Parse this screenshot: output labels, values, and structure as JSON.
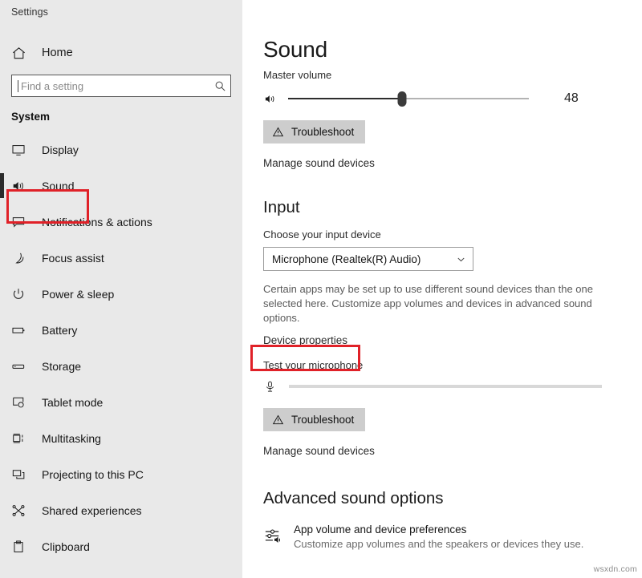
{
  "app": {
    "title": "Settings",
    "watermark": "wsxdn.com"
  },
  "colors": {
    "annotation": "#e02128",
    "sidebar_bg": "#e9e9e9",
    "main_bg": "#ffffff",
    "button_bg": "#cdcdcd",
    "slider_fill": "#2d2d2d",
    "slider_rest": "#b3b3b3"
  },
  "sidebar": {
    "home_label": "Home",
    "home_icon": "home-icon",
    "search": {
      "placeholder": "Find a setting",
      "value": "",
      "icon": "search-icon"
    },
    "section_title": "System",
    "items": [
      {
        "label": "Display",
        "icon": "monitor-icon",
        "selected": false
      },
      {
        "label": "Sound",
        "icon": "speaker-icon",
        "selected": true
      },
      {
        "label": "Notifications & actions",
        "icon": "speech-bubble-icon",
        "selected": false
      },
      {
        "label": "Focus assist",
        "icon": "moon-icon",
        "selected": false
      },
      {
        "label": "Power & sleep",
        "icon": "power-icon",
        "selected": false
      },
      {
        "label": "Battery",
        "icon": "battery-icon",
        "selected": false
      },
      {
        "label": "Storage",
        "icon": "storage-icon",
        "selected": false
      },
      {
        "label": "Tablet mode",
        "icon": "tablet-icon",
        "selected": false
      },
      {
        "label": "Multitasking",
        "icon": "multitasking-icon",
        "selected": false
      },
      {
        "label": "Projecting to this PC",
        "icon": "projecting-icon",
        "selected": false
      },
      {
        "label": "Shared experiences",
        "icon": "share-icon",
        "selected": false
      },
      {
        "label": "Clipboard",
        "icon": "clipboard-icon",
        "selected": false
      }
    ]
  },
  "main": {
    "page_title": "Sound",
    "output": {
      "master_volume_label": "Master volume",
      "volume_value": "48",
      "volume_percent": 48,
      "speaker_icon": "speaker-icon",
      "troubleshoot_label": "Troubleshoot",
      "troubleshoot_icon": "warning-triangle-icon",
      "manage_link": "Manage sound devices"
    },
    "input": {
      "heading": "Input",
      "choose_label": "Choose your input device",
      "device_value": "Microphone (Realtek(R) Audio)",
      "chevron_icon": "chevron-down-icon",
      "description": "Certain apps may be set up to use different sound devices than the one selected here. Customize app volumes and devices in advanced sound options.",
      "device_properties_link": "Device properties",
      "test_label": "Test your microphone",
      "mic_icon": "microphone-icon",
      "mic_level_percent": 0,
      "troubleshoot_label": "Troubleshoot",
      "troubleshoot_icon": "warning-triangle-icon",
      "manage_link": "Manage sound devices"
    },
    "advanced": {
      "heading": "Advanced sound options",
      "icon": "app-volume-mixer-icon",
      "item_title": "App volume and device preferences",
      "item_desc": "Customize app volumes and the speakers or devices they use."
    }
  },
  "annotations": [
    {
      "name": "sound-nav-highlight",
      "target": "Sound"
    },
    {
      "name": "device-properties-highlight",
      "target": "Device properties"
    }
  ]
}
